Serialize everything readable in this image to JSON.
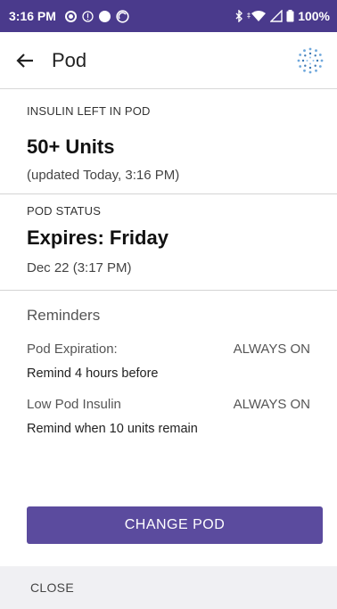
{
  "status_bar": {
    "time": "3:16 PM",
    "battery": "100%",
    "icons": [
      "record-icon",
      "info-icon",
      "circle-icon",
      "target-icon",
      "bluetooth-icon",
      "wifi-icon",
      "signal-icon",
      "battery-icon"
    ]
  },
  "header": {
    "title": "Pod",
    "back_icon": "arrow-left-icon",
    "logo_icon": "omnipod-logo-icon"
  },
  "insulin": {
    "label": "INSULIN LEFT IN POD",
    "value": "50+ Units",
    "updated": "(updated Today, 3:16 PM)"
  },
  "pod_status": {
    "label": "POD STATUS",
    "value": "Expires: Friday",
    "date": "Dec 22 (3:17 PM)"
  },
  "reminders": {
    "title": "Reminders",
    "items": [
      {
        "name": "Pod Expiration:",
        "state": "ALWAYS ON",
        "description": "Remind 4 hours before"
      },
      {
        "name": "Low Pod Insulin",
        "state": "ALWAYS ON",
        "description": "Remind when 10 units remain"
      }
    ]
  },
  "actions": {
    "change_pod": "CHANGE POD",
    "close": "CLOSE"
  },
  "colors": {
    "status_bar": "#4a3a8c",
    "primary_button": "#5b4b9e",
    "footer_bg": "#f0f0f3"
  }
}
